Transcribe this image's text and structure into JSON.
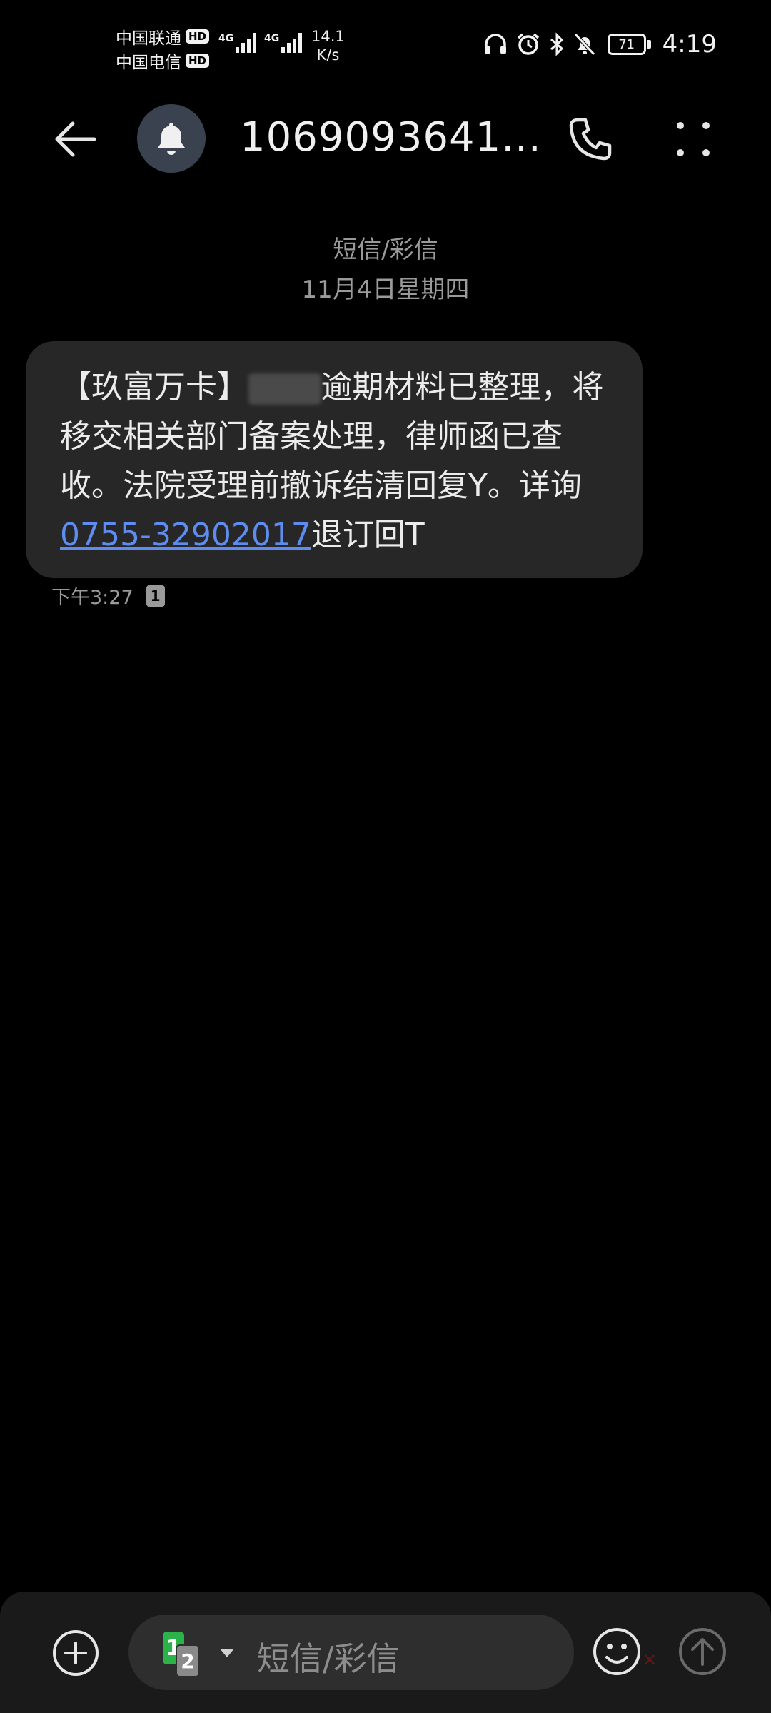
{
  "status_bar": {
    "carrier1": "中国联通",
    "carrier2": "中国电信",
    "hd_badge": "HD",
    "network_tag": "4G",
    "net_speed_value": "14.1",
    "net_speed_unit": "K/s",
    "battery": "71",
    "time": "4:19",
    "icons": [
      "headphones-icon",
      "alarm-icon",
      "bluetooth-icon",
      "mute-bell-icon"
    ]
  },
  "header": {
    "title": "1069093641...",
    "avatar_icon": "bell-icon"
  },
  "conversation": {
    "channel_label": "短信/彩信",
    "date_label": "11月4日星期四"
  },
  "message": {
    "text_before": "【玖富万卡】",
    "redacted": "███ ",
    "text_middle": "逾期材料已整理，将移交相关部门备案处理，律师函已查收。法院受理前撤诉结清回复Y。详询",
    "phone": "0755-32902017",
    "text_after": "退订回T",
    "time": "下午3:27",
    "sim": "1"
  },
  "composer": {
    "placeholder": "短信/彩信",
    "sim_primary": "1",
    "sim_secondary": "2"
  },
  "colors": {
    "background": "#000000",
    "bubble": "#272727",
    "link": "#5e8cf0",
    "sim1": "#2bb34a"
  }
}
